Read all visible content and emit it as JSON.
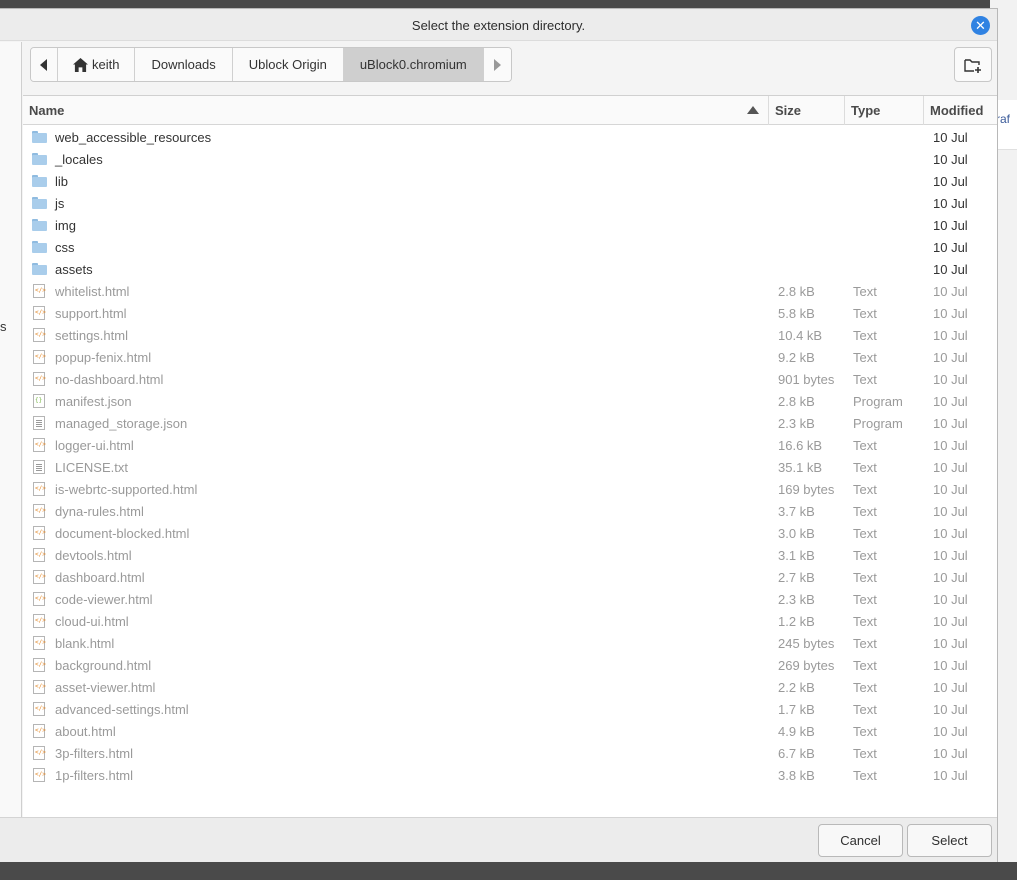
{
  "dialog": {
    "title": "Select the extension directory.",
    "close_label": "✕"
  },
  "pathbar": {
    "items": [
      "keith",
      "Downloads",
      "Ublock Origin",
      "uBlock0.chromium"
    ],
    "active_index": 3
  },
  "columns": {
    "name": "Name",
    "size": "Size",
    "type": "Type",
    "modified": "Modified"
  },
  "folders": [
    {
      "name": "web_accessible_resources",
      "modified": "10 Jul"
    },
    {
      "name": "_locales",
      "modified": "10 Jul"
    },
    {
      "name": "lib",
      "modified": "10 Jul"
    },
    {
      "name": "js",
      "modified": "10 Jul"
    },
    {
      "name": "img",
      "modified": "10 Jul"
    },
    {
      "name": "css",
      "modified": "10 Jul"
    },
    {
      "name": "assets",
      "modified": "10 Jul"
    }
  ],
  "files": [
    {
      "name": "whitelist.html",
      "size": "2.8 kB",
      "type": "Text",
      "modified": "10 Jul",
      "icon": "html"
    },
    {
      "name": "support.html",
      "size": "5.8 kB",
      "type": "Text",
      "modified": "10 Jul",
      "icon": "html"
    },
    {
      "name": "settings.html",
      "size": "10.4 kB",
      "type": "Text",
      "modified": "10 Jul",
      "icon": "html"
    },
    {
      "name": "popup-fenix.html",
      "size": "9.2 kB",
      "type": "Text",
      "modified": "10 Jul",
      "icon": "html"
    },
    {
      "name": "no-dashboard.html",
      "size": "901 bytes",
      "type": "Text",
      "modified": "10 Jul",
      "icon": "html"
    },
    {
      "name": "manifest.json",
      "size": "2.8 kB",
      "type": "Program",
      "modified": "10 Jul",
      "icon": "json"
    },
    {
      "name": "managed_storage.json",
      "size": "2.3 kB",
      "type": "Program",
      "modified": "10 Jul",
      "icon": "text"
    },
    {
      "name": "logger-ui.html",
      "size": "16.6 kB",
      "type": "Text",
      "modified": "10 Jul",
      "icon": "html"
    },
    {
      "name": "LICENSE.txt",
      "size": "35.1 kB",
      "type": "Text",
      "modified": "10 Jul",
      "icon": "text"
    },
    {
      "name": "is-webrtc-supported.html",
      "size": "169 bytes",
      "type": "Text",
      "modified": "10 Jul",
      "icon": "html"
    },
    {
      "name": "dyna-rules.html",
      "size": "3.7 kB",
      "type": "Text",
      "modified": "10 Jul",
      "icon": "html"
    },
    {
      "name": "document-blocked.html",
      "size": "3.0 kB",
      "type": "Text",
      "modified": "10 Jul",
      "icon": "html"
    },
    {
      "name": "devtools.html",
      "size": "3.1 kB",
      "type": "Text",
      "modified": "10 Jul",
      "icon": "html"
    },
    {
      "name": "dashboard.html",
      "size": "2.7 kB",
      "type": "Text",
      "modified": "10 Jul",
      "icon": "html"
    },
    {
      "name": "code-viewer.html",
      "size": "2.3 kB",
      "type": "Text",
      "modified": "10 Jul",
      "icon": "html"
    },
    {
      "name": "cloud-ui.html",
      "size": "1.2 kB",
      "type": "Text",
      "modified": "10 Jul",
      "icon": "html"
    },
    {
      "name": "blank.html",
      "size": "245 bytes",
      "type": "Text",
      "modified": "10 Jul",
      "icon": "html"
    },
    {
      "name": "background.html",
      "size": "269 bytes",
      "type": "Text",
      "modified": "10 Jul",
      "icon": "html"
    },
    {
      "name": "asset-viewer.html",
      "size": "2.2 kB",
      "type": "Text",
      "modified": "10 Jul",
      "icon": "html"
    },
    {
      "name": "advanced-settings.html",
      "size": "1.7 kB",
      "type": "Text",
      "modified": "10 Jul",
      "icon": "html"
    },
    {
      "name": "about.html",
      "size": "4.9 kB",
      "type": "Text",
      "modified": "10 Jul",
      "icon": "html"
    },
    {
      "name": "3p-filters.html",
      "size": "6.7 kB",
      "type": "Text",
      "modified": "10 Jul",
      "icon": "html"
    },
    {
      "name": "1p-filters.html",
      "size": "3.8 kB",
      "type": "Text",
      "modified": "10 Jul",
      "icon": "html"
    }
  ],
  "buttons": {
    "cancel": "Cancel",
    "select": "Select"
  },
  "background": {
    "peek_text": "raf",
    "sidebar_char": "s"
  },
  "colors": {
    "accent": "#2f82e2",
    "folder": "#a9cdeb",
    "html_icon": "#e38a2b",
    "json_icon": "#7db84c"
  }
}
